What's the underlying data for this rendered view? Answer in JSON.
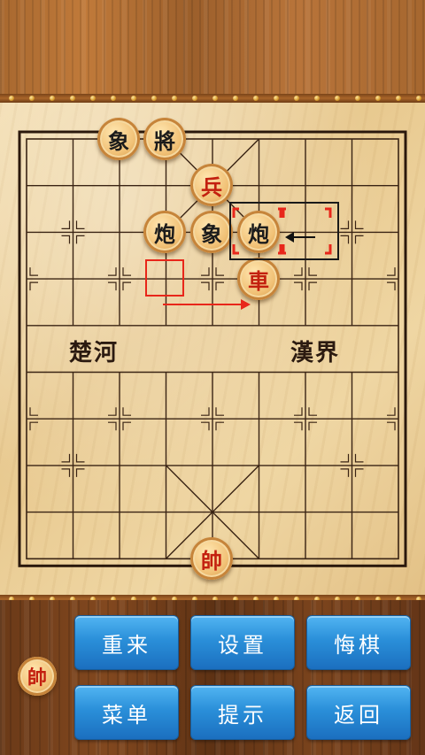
{
  "river": {
    "left": "楚河",
    "right": "漢界"
  },
  "pieces": {
    "black_elephant_top": "象",
    "black_general": "將",
    "red_soldier": "兵",
    "black_cannon_left": "炮",
    "black_elephant_mid": "象",
    "black_cannon_right": "炮",
    "red_chariot": "車",
    "red_marshal": "帥"
  },
  "player_indicator": "帥",
  "buttons": {
    "restart": "重来",
    "settings": "设置",
    "undo": "悔棋",
    "menu": "菜单",
    "hint": "提示",
    "back": "返回"
  },
  "colors": {
    "red_piece_text": "#c3200f",
    "black_piece_text": "#1b1b1b",
    "button_blue": "#2a8fd9",
    "move_marker_red": "#e8261a"
  }
}
